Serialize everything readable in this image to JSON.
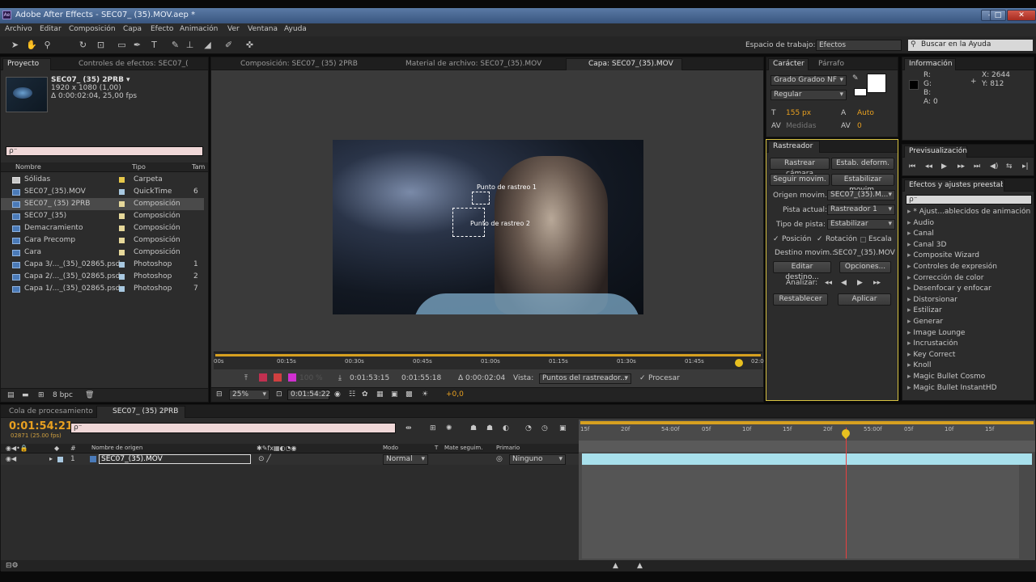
{
  "window": {
    "title": "Adobe After Effects - SEC07_ (35).MOV.aep *",
    "app_icon": "Ae"
  },
  "menu": [
    "Archivo",
    "Editar",
    "Composición",
    "Capa",
    "Efecto",
    "Animación",
    "Ver",
    "Ventana",
    "Ayuda"
  ],
  "toolbar": {
    "workspace_label": "Espacio de trabajo:",
    "workspace_value": "Efectos",
    "help_search_placeholder": "Buscar en la Ayuda"
  },
  "project_panel": {
    "tabs": [
      "Proyecto",
      "Controles de efectos: SEC07_("
    ],
    "item_name": "SEC07_ (35) 2PRB ▾",
    "item_res": "1920 x 1080 (1,00)",
    "item_dur": "Δ 0:00:02:04, 25,00 fps",
    "search_placeholder": "ρ⁻",
    "columns": [
      "Nombre",
      "Tipo",
      "Tamaño"
    ],
    "rows": [
      {
        "name": "Sólidas",
        "type": "Carpeta",
        "size": "",
        "label_color": "#e6c84a",
        "icon": "folder-icon"
      },
      {
        "name": "SEC07_(35).MOV",
        "type": "QuickTime",
        "size": "6",
        "label_color": "#a8c8e0",
        "icon": "footage-icon"
      },
      {
        "name": "SEC07_ (35) 2PRB",
        "type": "Composición",
        "size": "",
        "label_color": "#e6d89a",
        "icon": "comp-icon"
      },
      {
        "name": "SEC07_(35)",
        "type": "Composición",
        "size": "",
        "label_color": "#e6d89a",
        "icon": "comp-icon"
      },
      {
        "name": "Demacramiento",
        "type": "Composición",
        "size": "",
        "label_color": "#e6d89a",
        "icon": "comp-icon"
      },
      {
        "name": "Cara Precomp",
        "type": "Composición",
        "size": "",
        "label_color": "#e6d89a",
        "icon": "comp-icon"
      },
      {
        "name": "Cara",
        "type": "Composición",
        "size": "",
        "label_color": "#e6d89a",
        "icon": "comp-icon"
      },
      {
        "name": "Capa 3/..._(35)_02865.psd",
        "type": "Photoshop",
        "size": "1",
        "label_color": "#a8c8e0",
        "icon": "psd-icon"
      },
      {
        "name": "Capa 2/..._(35)_02865.psd",
        "type": "Photoshop",
        "size": "2",
        "label_color": "#a8c8e0",
        "icon": "psd-icon"
      },
      {
        "name": "Capa 1/..._(35)_02865.psd",
        "type": "Photoshop",
        "size": "7",
        "label_color": "#a8c8e0",
        "icon": "psd-icon"
      }
    ],
    "bpc": "8 bpc"
  },
  "viewer": {
    "tabs": [
      "Composición: SEC07_ (35) 2PRB",
      "Material de archivo: SEC07_(35).MOV",
      "Capa: SEC07_(35).MOV"
    ],
    "track_points": [
      "Punto de rastreo 1",
      "Punto de rastreo 2"
    ],
    "ruler": [
      "00s",
      "00:15s",
      "00:30s",
      "00:45s",
      "01:00s",
      "01:15s",
      "01:30s",
      "01:45s",
      "02:0"
    ],
    "in_point": "0:01:53:15",
    "out_point": "0:01:55:18",
    "duration": "Δ 0:00:02:04",
    "view_label": "Vista:",
    "view_value": "Puntos del rastreador...",
    "process_label": "Procesar",
    "zoom_pct": "100 %",
    "zoom": "25%",
    "current_time": "0:01:54:22",
    "exposure": "+0,0"
  },
  "character_panel": {
    "tabs": [
      "Carácter",
      "Párrafo"
    ],
    "font": "Grado Gradoo NF",
    "style": "Regular",
    "size": "155 px",
    "leading": "Auto",
    "kerning": "Medidas",
    "tracking": "0"
  },
  "tracker_panel": {
    "title": "Rastreador",
    "btn_track_camera": "Rastrear cámara",
    "btn_warp_stab": "Estab. deform.",
    "btn_track_motion": "Seguir movim.",
    "btn_stabilize": "Estabilizar movim.",
    "source_label": "Origen movim.:",
    "source_value": "SEC07_(35).M...",
    "track_label": "Pista actual:",
    "track_value": "Rastreador 1",
    "type_label": "Tipo de pista:",
    "type_value": "Estabilizar",
    "opt_position": "Posición",
    "opt_rotation": "Rotación",
    "opt_scale": "Escala",
    "target_label": "Destino movim.:",
    "target_value": "SEC07_(35).MOV",
    "btn_edit_target": "Editar destino...",
    "btn_options": "Opciones...",
    "analyze_label": "Analizar:",
    "btn_reset": "Restablecer",
    "btn_apply": "Aplicar"
  },
  "info_panel": {
    "title": "Información",
    "r": "R:",
    "g": "G:",
    "b": "B:",
    "a": "A:",
    "a_val": "0",
    "x": "X: 2644",
    "y": "Y: 812"
  },
  "preview_panel": {
    "title": "Previsualización"
  },
  "effects_panel": {
    "title": "Efectos y ajustes preestablecid",
    "search_placeholder": "ρ⁻",
    "items": [
      "* Ajust...ablecidos de animación",
      "Audio",
      "Canal",
      "Canal 3D",
      "Composite Wizard",
      "Controles de expresión",
      "Corrección de color",
      "Desenfocar y enfocar",
      "Distorsionar",
      "Estilizar",
      "Generar",
      "Image Lounge",
      "Incrustación",
      "Key Correct",
      "Knoll",
      "Magic Bullet Cosmo",
      "Magic Bullet InstantHD"
    ]
  },
  "timeline": {
    "tabs": [
      "Cola de procesamiento",
      "SEC07_ (35) 2PRB"
    ],
    "timecode": "0:01:54:21",
    "frames": "02871 (25.00 fps)",
    "search_placeholder": "ρ⁻",
    "columns": [
      "Nombre de origen",
      "Modo",
      "T",
      "Mate seguim.",
      "Primario"
    ],
    "layer": {
      "index": "1",
      "name": "SEC07_(35).MOV",
      "mode": "Normal",
      "parent": "Ninguno"
    },
    "ruler": [
      "15f",
      "20f",
      "54:00f",
      "05f",
      "10f",
      "15f",
      "20f",
      "55:00f",
      "05f",
      "10f",
      "15f"
    ],
    "playhead": 0.585
  },
  "colors": {
    "accent": "#e8a020",
    "selected": "#d7c242",
    "layer_bar": "#a8e0ec",
    "playhead": "#e84040"
  }
}
